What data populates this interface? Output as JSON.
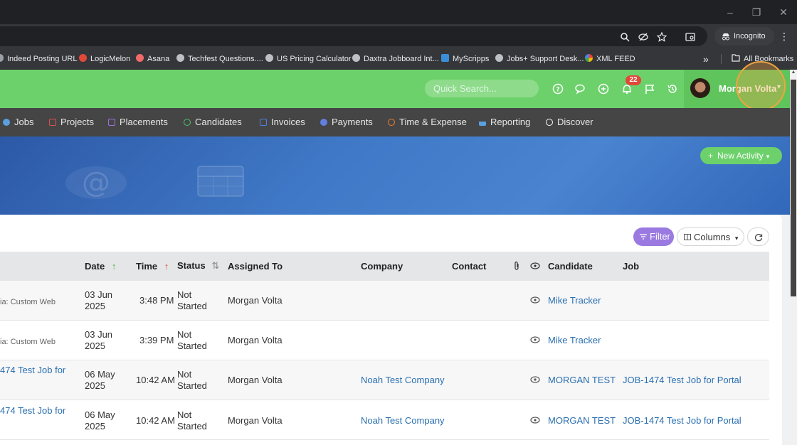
{
  "browser": {
    "incognito_label": "Incognito",
    "bookmarks": [
      {
        "label": "Indeed Posting URL",
        "color": "#9aa0a6"
      },
      {
        "label": "LogicMelon",
        "color": "#e0483a"
      },
      {
        "label": "Asana",
        "color": "#f06a6a"
      },
      {
        "label": "Techfest Questions....",
        "color": "#bdc1c6"
      },
      {
        "label": "US Pricing Calculator",
        "color": "#bdc1c6"
      },
      {
        "label": "Daxtra Jobboard Int...",
        "color": "#bdc1c6"
      },
      {
        "label": "MyScripps",
        "color": "#3b8fd9"
      },
      {
        "label": "Jobs+ Support Desk...",
        "color": "#bdc1c6"
      },
      {
        "label": "XML FEED",
        "color": "#f2b400"
      }
    ],
    "overflow_label": "»",
    "all_bookmarks_label": "All Bookmarks"
  },
  "header": {
    "search_placeholder": "Quick Search...",
    "notification_count": "22",
    "user_name": "Morgan Volta",
    "accent": "#6dd16b"
  },
  "nav": {
    "items": [
      {
        "label": "Jobs",
        "color": "#5aa0e0"
      },
      {
        "label": "Projects",
        "color": "#e05050"
      },
      {
        "label": "Placements",
        "color": "#a070e0"
      },
      {
        "label": "Candidates",
        "color": "#50c070"
      },
      {
        "label": "Invoices",
        "color": "#5080e0"
      },
      {
        "label": "Payments",
        "color": "#6080e0"
      },
      {
        "label": "Time & Expense",
        "color": "#f08030"
      },
      {
        "label": "Reporting",
        "color": "#5aa0e0"
      },
      {
        "label": "Discover",
        "color": "#ffffff"
      }
    ]
  },
  "banner": {
    "new_activity_label": "New Activity"
  },
  "toolbar": {
    "filter_label": "Filter",
    "columns_label": "Columns"
  },
  "table": {
    "headers": {
      "date": "Date",
      "time": "Time",
      "status": "Status",
      "assigned_to": "Assigned To",
      "company": "Company",
      "contact": "Contact",
      "candidate": "Candidate",
      "job": "Job"
    },
    "rows": [
      {
        "subject": "ia: Custom Web",
        "subject_link": false,
        "date1": "03 Jun",
        "date2": "2025",
        "time": "3:48 PM",
        "status1": "Not",
        "status2": "Started",
        "assigned": "Morgan Volta",
        "company": "",
        "contact": "",
        "candidate": "Mike Tracker",
        "job": ""
      },
      {
        "subject": "ia: Custom Web",
        "subject_link": false,
        "date1": "03 Jun",
        "date2": "2025",
        "time": "3:39 PM",
        "status1": "Not",
        "status2": "Started",
        "assigned": "Morgan Volta",
        "company": "",
        "contact": "",
        "candidate": "Mike Tracker",
        "job": ""
      },
      {
        "subject": "474 Test Job for",
        "subject_link": true,
        "date1": "06 May",
        "date2": "2025",
        "time": "10:42 AM",
        "status1": "Not",
        "status2": "Started",
        "assigned": "Morgan Volta",
        "company": "Noah Test Company",
        "contact": "",
        "candidate": "MORGAN TEST",
        "job": "JOB-1474 Test Job for Portal"
      },
      {
        "subject": "474 Test Job for",
        "subject_link": true,
        "date1": "06 May",
        "date2": "2025",
        "time": "10:42 AM",
        "status1": "Not",
        "status2": "Started",
        "assigned": "Morgan Volta",
        "company": "Noah Test Company",
        "contact": "",
        "candidate": "MORGAN TEST",
        "job": "JOB-1474 Test Job for Portal"
      }
    ]
  }
}
